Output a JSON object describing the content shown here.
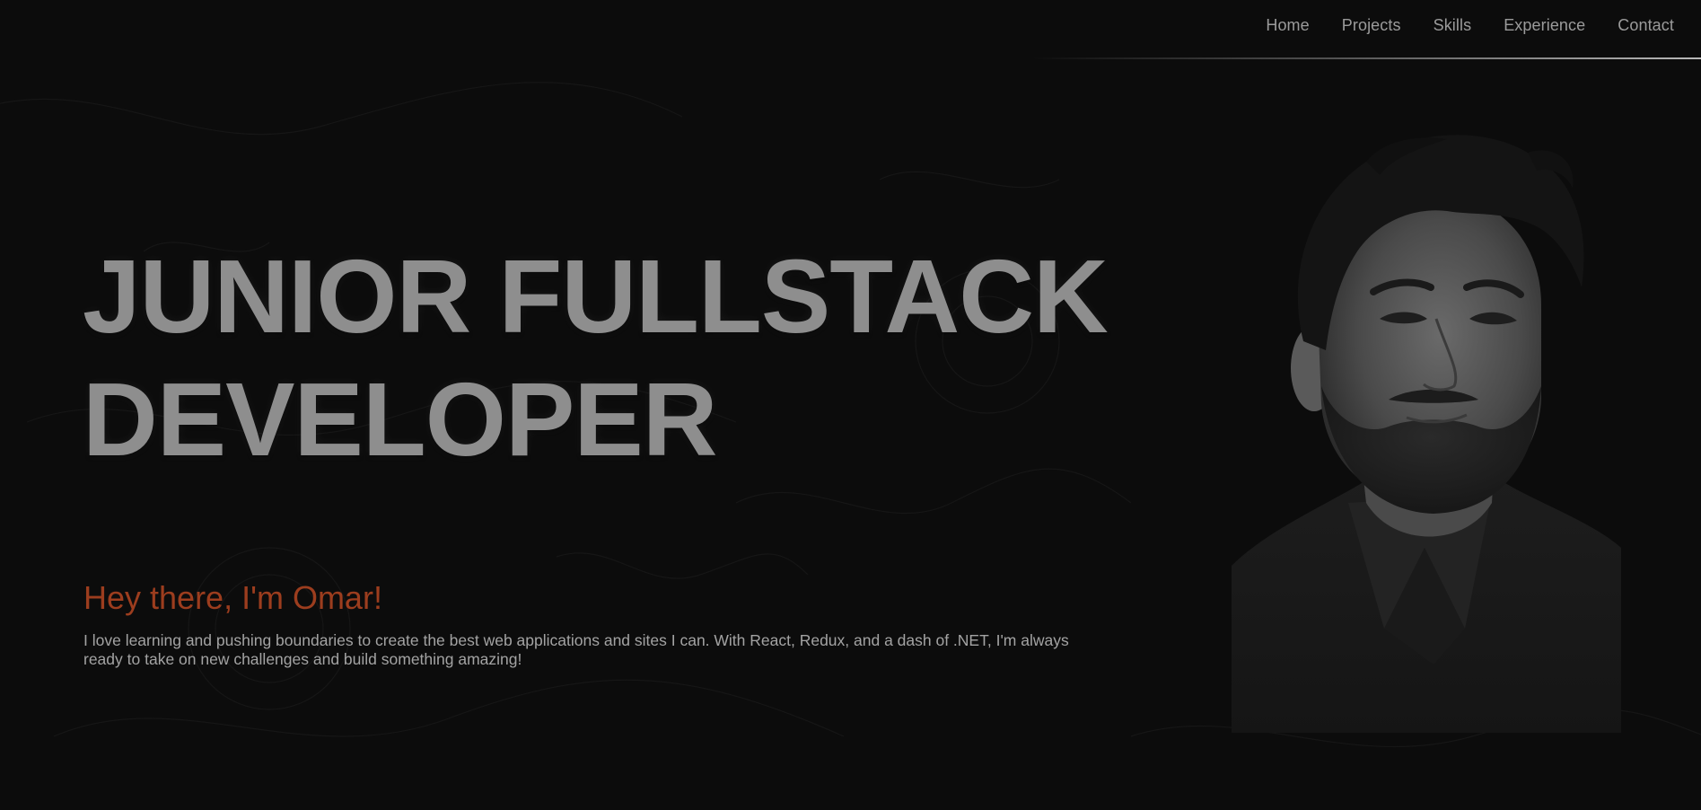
{
  "nav": {
    "items": [
      {
        "label": "Home"
      },
      {
        "label": "Projects"
      },
      {
        "label": "Skills"
      },
      {
        "label": "Experience"
      },
      {
        "label": "Contact"
      }
    ]
  },
  "hero": {
    "title_line1": "JUNIOR FULLSTACK",
    "title_line2": "DEVELOPER",
    "greeting": "Hey there, I'm Omar!",
    "intro": "I love learning and pushing boundaries to create the best web applications and sites I can. With React, Redux, and a dash of .NET, I'm always ready to take on new challenges and build something amazing!"
  },
  "colors": {
    "background": "#0c0c0c",
    "accent": "#9c3d1e",
    "headline": "#8e8e8e",
    "body_text": "#a3a3a3",
    "nav_text": "#9b9b9b"
  },
  "icons": [
    "portrait-photo"
  ]
}
